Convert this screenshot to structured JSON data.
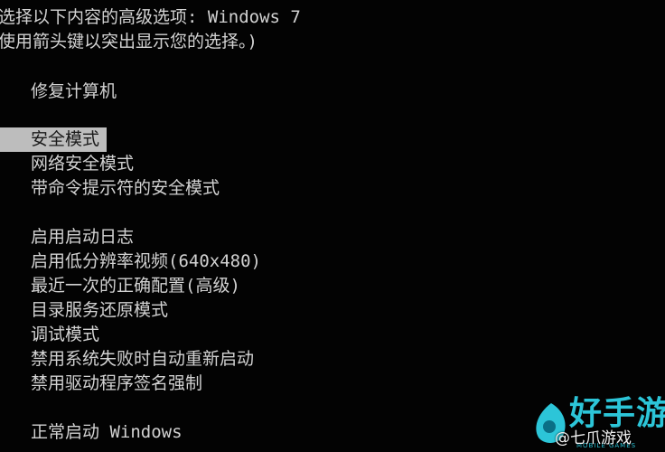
{
  "header": {
    "line1": "选择以下内容的高级选项: Windows 7",
    "line2": "使用箭头键以突出显示您的选择。)"
  },
  "menu": {
    "repair": "修复计算机",
    "safe_mode_group": [
      "安全模式",
      "网络安全模式",
      "带命令提示符的安全模式"
    ],
    "selected_index": 0,
    "boot_options": [
      "启用启动日志",
      "启用低分辨率视频(640x480)",
      "最近一次的正确配置(高级)",
      "目录服务还原模式",
      "调试模式",
      "禁用系统失败时自动重新启动",
      "禁用驱动程序签名强制"
    ],
    "normal_start": "正常启动 Windows"
  },
  "watermark": {
    "title": "好手游网",
    "subtitle": "MOBILE GAMES",
    "handle": "@七爪游戏",
    "accent_color": "#2cc5d8",
    "logo_icon": "leaf-logo-icon"
  },
  "colors": {
    "background": "#030303",
    "text": "#d2d2d2",
    "highlight_bg": "#bdbdbd",
    "highlight_text": "#1a1a1a"
  }
}
